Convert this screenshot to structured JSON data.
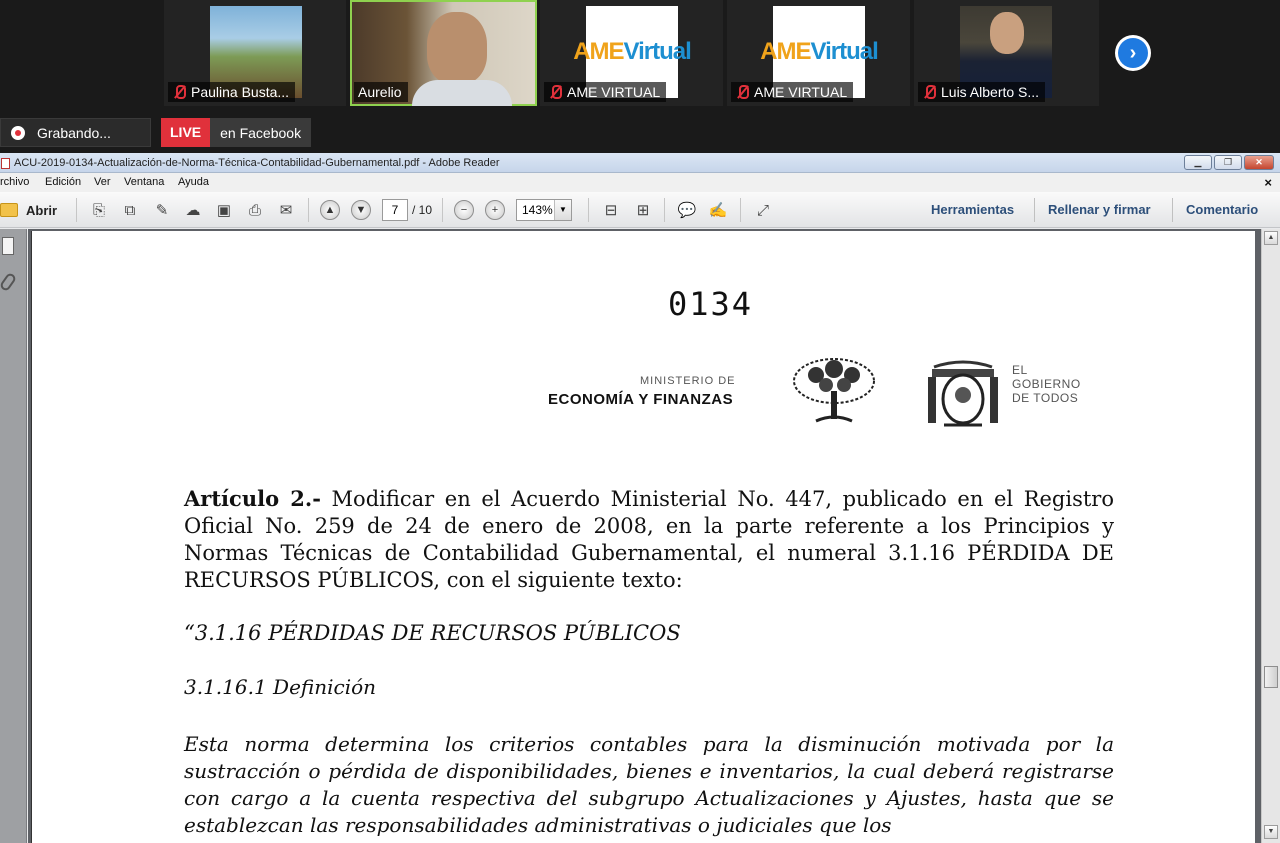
{
  "participants": [
    {
      "name": "Paulina Busta...",
      "muted": true
    },
    {
      "name": "Aurelio",
      "muted": false
    },
    {
      "name": "AME VIRTUAL",
      "muted": true,
      "logo_text_a": "AME",
      "logo_text_b": "Virtual"
    },
    {
      "name": "AME VIRTUAL",
      "muted": true,
      "logo_text_a": "AME",
      "logo_text_b": "Virtual"
    },
    {
      "name": "Luis Alberto S...",
      "muted": true
    }
  ],
  "recording": {
    "label": "Grabando..."
  },
  "live": {
    "badge": "LIVE",
    "label": "en Facebook"
  },
  "reader": {
    "title": "ACU-2019-0134-Actualización-de-Norma-Técnica-Contabilidad-Gubernamental.pdf - Adobe Reader",
    "menu": [
      "rchivo",
      "Edición",
      "Ver",
      "Ventana",
      "Ayuda"
    ],
    "open_label": "Abrir",
    "page_current": "7",
    "page_total": "/ 10",
    "zoom": "143%",
    "right_links": [
      "Herramientas",
      "Rellenar y firmar",
      "Comentario"
    ]
  },
  "document": {
    "number": "0134",
    "ministry_small": "MINISTERIO DE",
    "ministry": "ECONOMÍA Y FINANZAS",
    "gobierno": "EL\nGOBIERNO\nDE TODOS",
    "article_label": "Artículo 2.-",
    "article_text": " Modificar en el Acuerdo Ministerial No. 447, publicado en el Registro Oficial No. 259 de 24 de enero de 2008, en la parte referente a los Principios y Normas Técnicas de Contabilidad Gubernamental, el numeral 3.1.16 PÉRDIDA DE RECURSOS PÚBLICOS, con el siguiente texto:",
    "section_title": "“3.1.16 PÉRDIDAS DE RECURSOS PÚBLICOS",
    "subsection_title": "3.1.16.1 Definición",
    "definition_text": "Esta norma determina los criterios contables para la disminución motivada por la sustracción o pérdida de disponibilidades, bienes e inventarios, la cual deberá registrarse con cargo a la cuenta respectiva del subgrupo Actualizaciones y Ajustes, hasta que se establezcan las responsabilidades administrativas o judiciales que los"
  }
}
